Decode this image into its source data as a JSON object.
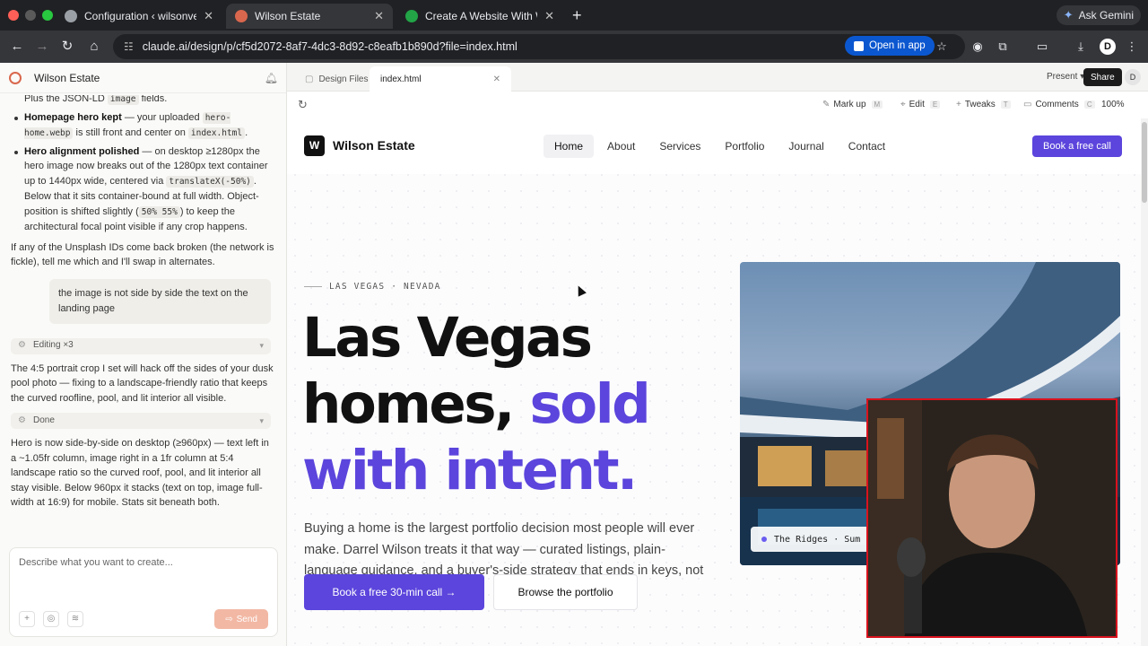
{
  "browser": {
    "tabs": [
      {
        "title": "Configuration ‹ wilsonvegas",
        "favicon_color": "#9aa0a6"
      },
      {
        "title": "Wilson Estate",
        "favicon_color": "#d9674d"
      },
      {
        "title": "Create A Website With WordP",
        "favicon_color": "#22a447"
      }
    ],
    "gemini_label": "Ask Gemini",
    "url": "claude.ai/design/p/cf5d2072-8af7-4dc3-8d92-c8eafb1b890d?file=index.html",
    "open_in_app": "Open in app",
    "profile_initial": "D"
  },
  "chat": {
    "title": "Wilson Estate",
    "line_jsonld_pre": "Plus the JSON-LD ",
    "line_jsonld_code": "image",
    "line_jsonld_post": " fields.",
    "bullet1_bold": "Homepage hero kept",
    "bullet1_text_a": " — your uploaded ",
    "bullet1_code_a": "hero-home.webp",
    "bullet1_text_b": " is still front and center on ",
    "bullet1_code_b": "index.html",
    "bullet1_text_c": ".",
    "bullet2_bold": "Hero alignment polished",
    "bullet2_text_a": " — on desktop ≥1280px the hero image now breaks out of the 1280px text container up to 1440px wide, centered via ",
    "bullet2_code_a": "translateX(-50%)",
    "bullet2_text_b": ". Below that it sits container-bound at full width. Object-position is shifted slightly (",
    "bullet2_code_b": "50% 55%",
    "bullet2_text_c": ") to keep the architectural focal point visible if any crop happens.",
    "para_unsplash": "If any of the Unsplash IDs come back broken (the network is fickle), tell me which and I'll swap in alternates.",
    "user_message": "the image is not side by side the text on the landing page",
    "tool_editing": "Editing ×3",
    "para_crop": "The 4:5 portrait crop I set will hack off the sides of your dusk pool photo — fixing to a landscape-friendly ratio that keeps the curved roofline, pool, and lit interior all visible.",
    "tool_done": "Done",
    "para_result": "Hero is now side-by-side on desktop (≥960px) — text left in a ~1.05fr column, image right in a 1fr column at 5:4 landscape ratio so the curved roof, pool, and lit interior all stay visible. Below 960px it stacks (text on top, image full-width at 16:9) for mobile. Stats sit beneath both.",
    "composer_placeholder": "Describe what you want to create...",
    "send_label": "Send"
  },
  "design": {
    "tabs": {
      "files": "Design Files",
      "current": "index.html"
    },
    "present_label": "Present",
    "share_label": "Share",
    "avatar_initial": "D",
    "tools": {
      "markup": "Mark up",
      "markup_key": "M",
      "edit": "Edit",
      "edit_key": "E",
      "tweaks": "Tweaks",
      "tweaks_key": "T",
      "comments": "Comments",
      "comments_key": "C"
    },
    "zoom": "100%"
  },
  "site": {
    "brand_initial": "W",
    "brand_name": "Wilson Estate",
    "nav": [
      "Home",
      "About",
      "Services",
      "Portfolio",
      "Journal",
      "Contact"
    ],
    "nav_cta": "Book a free call",
    "eyebrow": "LAS VEGAS · NEVADA",
    "headline_l1": "Las Vegas",
    "headline_l2a": "homes, ",
    "headline_l2b": "sold",
    "headline_l3": "with intent.",
    "lede": "Buying a home is the largest portfolio decision most people will ever make. Darrel Wilson treats it that way — curated listings, plain-language guidance, and a buyer's-side strategy that ends in keys, not pressure.",
    "cta_primary": "Book a free 30-min call →",
    "cta_secondary": "Browse the portfolio",
    "hero_caption": "The Ridges · Sum"
  },
  "colors": {
    "accent": "#5b45dc",
    "send": "#f2b8a4",
    "webcam_border": "#d9121e"
  }
}
